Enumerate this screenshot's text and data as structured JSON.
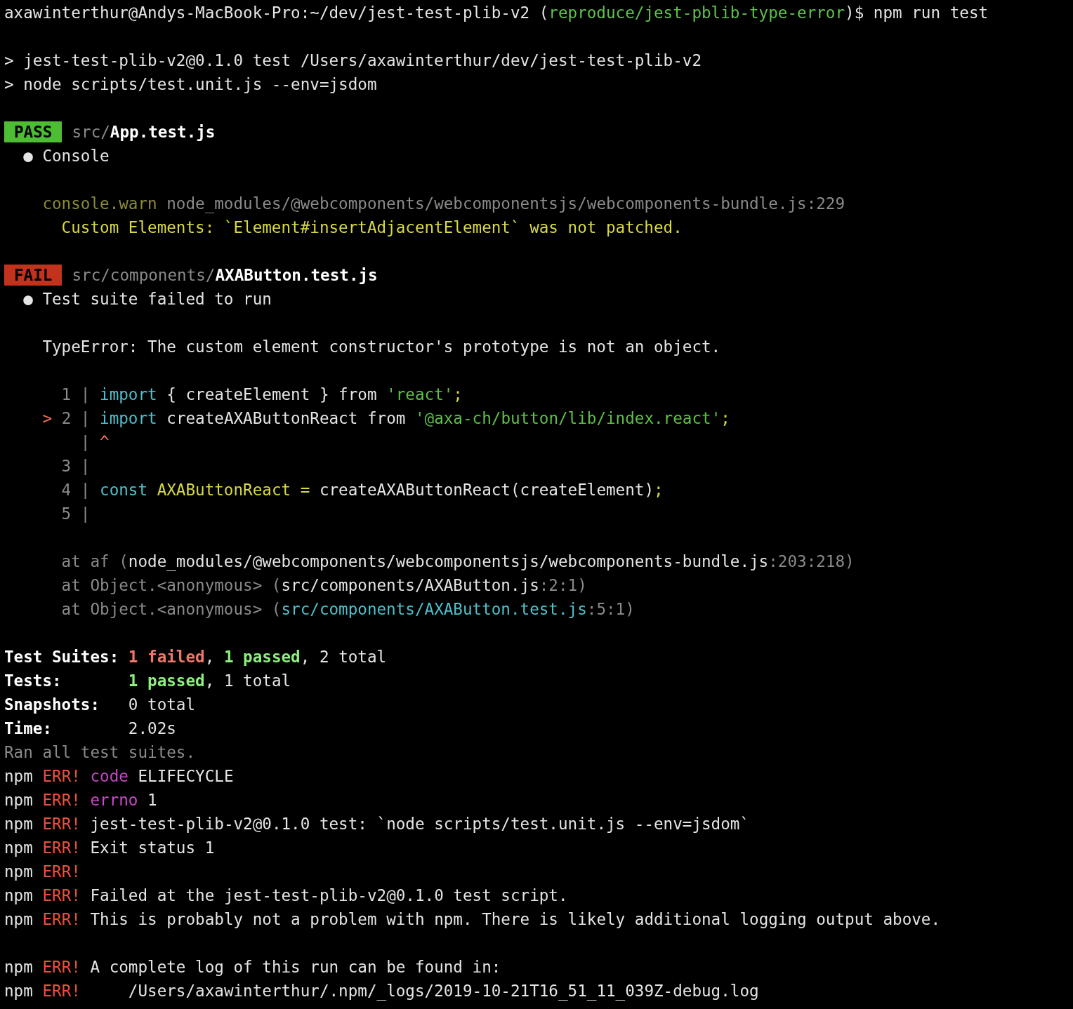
{
  "blocks": [
    [
      {
        "segments": [
          {
            "text": "axawinterthur@Andys-MacBook-Pro:~/dev/jest-test-plib-v2 (",
            "kind": "plain"
          },
          {
            "text": "reproduce/jest-pblib-type-error",
            "kind": "green"
          },
          {
            "text": ")$ npm run test",
            "kind": "plain"
          }
        ]
      }
    ],
    [
      {
        "segments": [
          {
            "text": "> jest-test-plib-v2@0.1.0 test /Users/axawinterthur/dev/jest-test-plib-v2",
            "kind": "plain"
          }
        ]
      },
      {
        "segments": [
          {
            "text": "> node scripts/test.unit.js --env=jsdom",
            "kind": "plain"
          }
        ]
      }
    ],
    [
      {
        "badge": {
          "text": "PASS",
          "kind": "pass"
        },
        "segments": [
          {
            "text": "src/",
            "kind": "dim"
          },
          {
            "text": "App.test.js",
            "kind": "bold"
          }
        ]
      },
      {
        "segments": [
          {
            "text": "  ● Console",
            "kind": "plain"
          }
        ]
      }
    ],
    [
      {
        "segments": [
          {
            "text": "    console.warn",
            "kind": "olive"
          },
          {
            "text": " node_modules/@webcomponents/webcomponentsjs/webcomponents-bundle.js:229",
            "kind": "dim"
          }
        ]
      },
      {
        "segments": [
          {
            "text": "      Custom Elements: `Element#insertAdjacentElement` was not patched.",
            "kind": "yellow"
          }
        ]
      }
    ],
    [
      {
        "badge": {
          "text": "FAIL",
          "kind": "fail"
        },
        "segments": [
          {
            "text": "src/components/",
            "kind": "dim"
          },
          {
            "text": "AXAButton.test.js",
            "kind": "bold"
          }
        ]
      },
      {
        "segments": [
          {
            "text": "  ● Test suite failed to run",
            "kind": "plain"
          }
        ]
      }
    ],
    [
      {
        "segments": [
          {
            "text": "    TypeError: The custom element constructor's prototype is not an object.",
            "kind": "plain"
          }
        ]
      }
    ],
    [
      {
        "segments": [
          {
            "text": "      1 | ",
            "kind": "dim"
          },
          {
            "text": "import",
            "kind": "cyan"
          },
          {
            "text": " { createElement } from ",
            "kind": "plain"
          },
          {
            "text": "'react'",
            "kind": "string"
          },
          {
            "text": ";",
            "kind": "yellow"
          }
        ]
      },
      {
        "segments": [
          {
            "text": "    > ",
            "kind": "red"
          },
          {
            "text": "2 | ",
            "kind": "dim"
          },
          {
            "text": "import",
            "kind": "cyan"
          },
          {
            "text": " createAXAButtonReact from ",
            "kind": "plain"
          },
          {
            "text": "'@axa-ch/button/lib/index.react'",
            "kind": "string"
          },
          {
            "text": ";",
            "kind": "yellow"
          }
        ]
      },
      {
        "segments": [
          {
            "text": "        | ",
            "kind": "dim"
          },
          {
            "text": "^",
            "kind": "red"
          }
        ]
      },
      {
        "segments": [
          {
            "text": "      3 |",
            "kind": "dim"
          }
        ]
      },
      {
        "segments": [
          {
            "text": "      4 | ",
            "kind": "dim"
          },
          {
            "text": "const",
            "kind": "cyan"
          },
          {
            "text": " AXAButtonReact = ",
            "kind": "yellow"
          },
          {
            "text": "createAXAButtonReact(createElement)",
            "kind": "plain"
          },
          {
            "text": ";",
            "kind": "yellow"
          }
        ]
      },
      {
        "segments": [
          {
            "text": "      5 |",
            "kind": "dim"
          }
        ]
      }
    ],
    [
      {
        "segments": [
          {
            "text": "      at af (",
            "kind": "dim"
          },
          {
            "text": "node_modules/@webcomponents/webcomponentsjs/webcomponents-bundle.js",
            "kind": "plain"
          },
          {
            "text": ":203:218)",
            "kind": "dim"
          }
        ]
      },
      {
        "segments": [
          {
            "text": "      at Object.<anonymous> (",
            "kind": "dim"
          },
          {
            "text": "src/components/AXAButton.js",
            "kind": "plain"
          },
          {
            "text": ":2:1)",
            "kind": "dim"
          }
        ]
      },
      {
        "segments": [
          {
            "text": "      at Object.<anonymous> (",
            "kind": "dim"
          },
          {
            "text": "src/components/AXAButton.test.js",
            "kind": "cyan"
          },
          {
            "text": ":5:1)",
            "kind": "dim"
          }
        ]
      }
    ],
    [
      {
        "segments": [
          {
            "text": "Test Suites: ",
            "kind": "bold"
          },
          {
            "text": "1 failed",
            "kind": "failcount"
          },
          {
            "text": ", ",
            "kind": "plain"
          },
          {
            "text": "1 passed",
            "kind": "passcount"
          },
          {
            "text": ", 2 total",
            "kind": "plain"
          }
        ]
      },
      {
        "segments": [
          {
            "text": "Tests:       ",
            "kind": "bold"
          },
          {
            "text": "1 passed",
            "kind": "passcount"
          },
          {
            "text": ", 1 total",
            "kind": "plain"
          }
        ]
      },
      {
        "segments": [
          {
            "text": "Snapshots:   ",
            "kind": "bold"
          },
          {
            "text": "0 total",
            "kind": "plain"
          }
        ]
      },
      {
        "segments": [
          {
            "text": "Time:        ",
            "kind": "bold"
          },
          {
            "text": "2.02s",
            "kind": "plain"
          }
        ]
      },
      {
        "segments": [
          {
            "text": "Ran all test suites.",
            "kind": "dim"
          }
        ]
      },
      {
        "segments": [
          {
            "text": "npm ",
            "kind": "plain"
          },
          {
            "text": "ERR!",
            "kind": "err"
          },
          {
            "text": " code",
            "kind": "magenta"
          },
          {
            "text": " ELIFECYCLE",
            "kind": "plain"
          }
        ]
      },
      {
        "segments": [
          {
            "text": "npm ",
            "kind": "plain"
          },
          {
            "text": "ERR!",
            "kind": "err"
          },
          {
            "text": " errno",
            "kind": "magenta"
          },
          {
            "text": " 1",
            "kind": "plain"
          }
        ]
      },
      {
        "segments": [
          {
            "text": "npm ",
            "kind": "plain"
          },
          {
            "text": "ERR!",
            "kind": "err"
          },
          {
            "text": " jest-test-plib-v2@0.1.0 test: `node scripts/test.unit.js --env=jsdom`",
            "kind": "plain"
          }
        ]
      },
      {
        "segments": [
          {
            "text": "npm ",
            "kind": "plain"
          },
          {
            "text": "ERR!",
            "kind": "err"
          },
          {
            "text": " Exit status 1",
            "kind": "plain"
          }
        ]
      },
      {
        "segments": [
          {
            "text": "npm ",
            "kind": "plain"
          },
          {
            "text": "ERR!",
            "kind": "err"
          }
        ]
      },
      {
        "segments": [
          {
            "text": "npm ",
            "kind": "plain"
          },
          {
            "text": "ERR!",
            "kind": "err"
          },
          {
            "text": " Failed at the jest-test-plib-v2@0.1.0 test script.",
            "kind": "plain"
          }
        ]
      },
      {
        "segments": [
          {
            "text": "npm ",
            "kind": "plain"
          },
          {
            "text": "ERR!",
            "kind": "err"
          },
          {
            "text": " This is probably not a problem with npm. There is likely additional logging output above.",
            "kind": "plain"
          }
        ]
      }
    ],
    [
      {
        "segments": [
          {
            "text": "npm ",
            "kind": "plain"
          },
          {
            "text": "ERR!",
            "kind": "err"
          },
          {
            "text": " A complete log of this run can be found in:",
            "kind": "plain"
          }
        ]
      },
      {
        "segments": [
          {
            "text": "npm ",
            "kind": "plain"
          },
          {
            "text": "ERR!",
            "kind": "err"
          },
          {
            "text": "     /Users/axawinterthur/.npm/_logs/2019-10-21T16_51_11_039Z-debug.log",
            "kind": "plain"
          }
        ]
      }
    ]
  ]
}
